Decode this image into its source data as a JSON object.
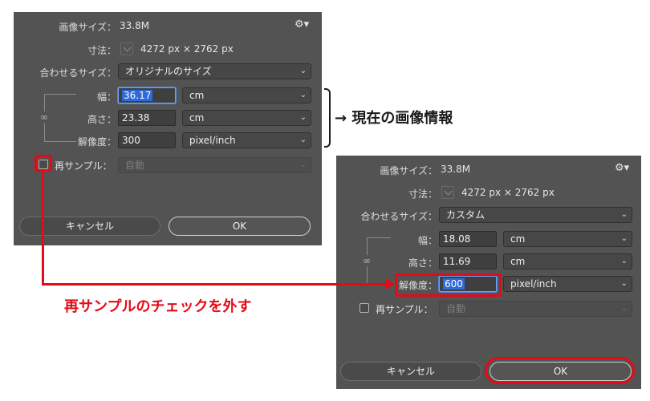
{
  "dialog_before": {
    "image_size_label": "画像サイズ：",
    "image_size_value": "33.8M",
    "dimensions_label": "寸法：",
    "dimensions_value": "4272 px × 2762 px",
    "fit_label": "合わせるサイズ：",
    "fit_value": "オリジナルのサイズ",
    "width_label": "幅：",
    "width_value": "36.17",
    "width_unit": "cm",
    "height_label": "高さ：",
    "height_value": "23.38",
    "height_unit": "cm",
    "resolution_label": "解像度：",
    "resolution_value": "300",
    "resolution_unit": "pixel/inch",
    "resample_label": "再サンプル：",
    "resample_value": "自動",
    "resample_checked": false,
    "cancel_label": "キャンセル",
    "ok_label": "OK"
  },
  "dialog_after": {
    "image_size_label": "画像サイズ：",
    "image_size_value": "33.8M",
    "dimensions_label": "寸法：",
    "dimensions_value": "4272 px × 2762 px",
    "fit_label": "合わせるサイズ：",
    "fit_value": "カスタム",
    "width_label": "幅：",
    "width_value": "18.08",
    "width_unit": "cm",
    "height_label": "高さ：",
    "height_value": "11.69",
    "height_unit": "cm",
    "resolution_label": "解像度：",
    "resolution_value": "600",
    "resolution_unit": "pixel/inch",
    "resample_label": "再サンプル：",
    "resample_value": "自動",
    "resample_checked": false,
    "cancel_label": "キャンセル",
    "ok_label": "OK"
  },
  "annotations": {
    "current_info": "→ 現在の画像情報",
    "uncheck_resample": "再サンプルのチェックを外す"
  },
  "icons": {
    "gear": "gear-icon",
    "chevron": "chevron-down-icon",
    "link": "chain-link-icon"
  },
  "colors": {
    "dialog_bg": "#535353",
    "highlight_red": "#e30b17",
    "selection_blue": "#2f6bd6"
  }
}
